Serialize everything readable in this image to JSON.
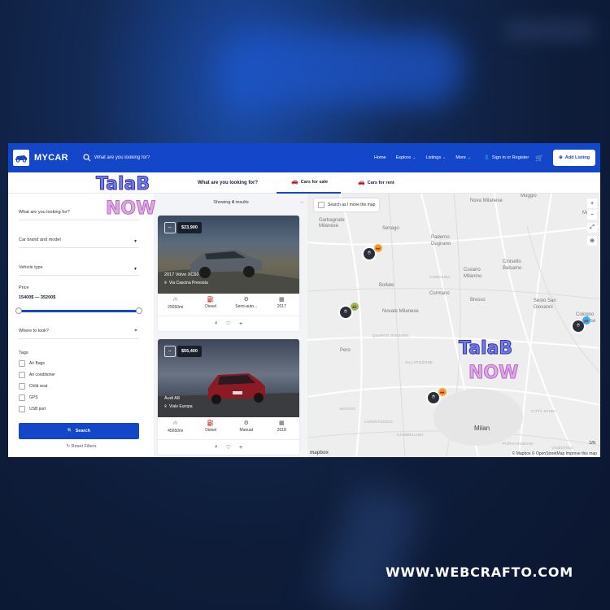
{
  "app": {
    "brand": "MYCAR",
    "search_placeholder": "What are you looking for?"
  },
  "nav": {
    "home": "Home",
    "explore": "Explore",
    "listings": "Listings",
    "more": "More",
    "signin": "Sign in or Register",
    "add_listing": "Add Listing"
  },
  "tabs": {
    "heading": "What are you looking for?",
    "items": [
      {
        "label": "Cars for sale",
        "active": true
      },
      {
        "label": "Cars for rent",
        "active": false
      }
    ]
  },
  "filters": {
    "keyword_placeholder": "What are you looking for?",
    "brand_model": "Car brand and model",
    "vehicle_type": "Vehicle type",
    "price_label": "Price",
    "price_range": "15400$ — 35200$",
    "price_min_fraction": 0.0,
    "price_max_fraction": 1.0,
    "where": "Where to look?",
    "tags_label": "Tags",
    "tags": [
      {
        "label": "Air Bags",
        "checked": false
      },
      {
        "label": "Air conditioner",
        "checked": false
      },
      {
        "label": "Child seat",
        "checked": false
      },
      {
        "label": "GPS",
        "checked": false
      },
      {
        "label": "USB port",
        "checked": false
      }
    ],
    "search_button": "Search",
    "reset": "Reset Filters"
  },
  "results": {
    "showing_prefix": "Showing",
    "count": "4",
    "showing_suffix": "results",
    "cards": [
      {
        "price": "$23,900",
        "title": "2017 Volvo XC60",
        "location": "Via Cascina Prevosta",
        "mileage": "25650mi",
        "fuel": "Diesel",
        "transmission": "Semi-auto...",
        "year": "2017"
      },
      {
        "price": "$55,400",
        "title": "Audi A8",
        "location": "Viale Europa",
        "mileage": "45650mi",
        "fuel": "Diesel",
        "transmission": "Manual",
        "year": "2018"
      }
    ]
  },
  "map": {
    "search_as_move": "Search as I move the map",
    "labels": {
      "nova_milanese": "Nova Milanese",
      "muggio": "Muggiò",
      "garbagnate": "Garbagnate Milanese",
      "senago": "Senago",
      "paderno": "Paderno Dugnano",
      "cinisello": "Cinisello Balsamo",
      "cusano": "Cusano Milanino",
      "bollate": "Bollate",
      "cormano": "Cormano",
      "bresso": "Bresso",
      "sesto": "Sesto San Giovanni",
      "novate": "Novate Milanese",
      "cologno": "Cologno Monzese",
      "pero": "Pero",
      "milan": "Milan",
      "monza": "Monz",
      "baggio": "BAGGIO",
      "vigentino": "VIGENTINO",
      "porta_romana": "PORTA ROMANA",
      "comasina": "COMASINA",
      "quarto_oggiaro": "QUARTO OGGIARO",
      "villapizzone": "VILLAPIZZONE",
      "city_studi": "CITTÀ STUDI",
      "lorenteggio": "LORENTEGGIO",
      "giambellino": "GIAMBELLINO"
    },
    "attribution": "© Mapbox © OpenStreetMap  Improve this map",
    "logo": "mapbox",
    "scale": "1/N"
  },
  "watermark": {
    "line1": "TalaB",
    "line2": "NOW"
  },
  "footer": {
    "site": "WWW.WEBCRAFTO.COM"
  },
  "colors": {
    "primary": "#1346c8",
    "marker": "#2b2f3a",
    "badge_orange": "#f0a623",
    "badge_green": "#8bc34a",
    "badge_blue": "#29b6f6"
  }
}
